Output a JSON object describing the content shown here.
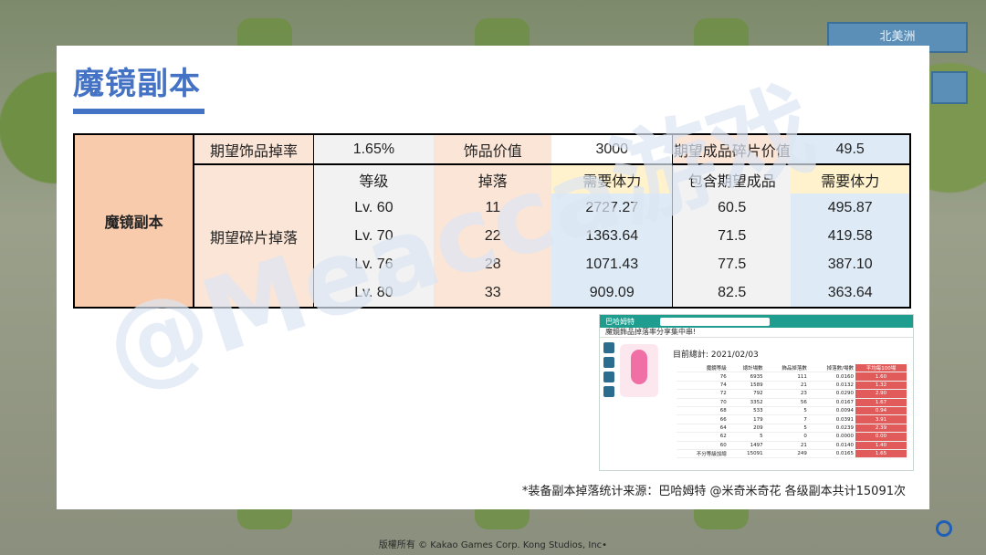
{
  "background": {
    "region_label": "北美洲",
    "copyright": "版權所有 © Kakao Games Corp. Kong Studios, Inc•"
  },
  "slide": {
    "title": "魔镜副本",
    "watermark": "@Meacca游戏",
    "accent_color": "#4472c4",
    "table": {
      "side_label": "魔镜副本",
      "row1": {
        "label1": "期望饰品掉率",
        "value1": "1.65%",
        "label2": "饰品价值",
        "value2": "3000",
        "label3": "期望成品碎片价值",
        "value3": "49.5"
      },
      "sub_label": "期望碎片掉落",
      "headers": [
        "等级",
        "掉落",
        "需要体力",
        "包含期望成品",
        "需要体力"
      ],
      "rows": [
        [
          "Lv. 60",
          "11",
          "2727.27",
          "60.5",
          "495.87"
        ],
        [
          "Lv. 70",
          "22",
          "1363.64",
          "71.5",
          "419.58"
        ],
        [
          "Lv. 76",
          "28",
          "1071.43",
          "77.5",
          "387.10"
        ],
        [
          "Lv. 80",
          "33",
          "909.09",
          "82.5",
          "363.64"
        ]
      ]
    },
    "screenshot": {
      "logo": "巴哈姆特",
      "header": "魔鏡飾品掉落率分享集中串!",
      "date": "目前總計: 2021/02/03",
      "columns": [
        "魔鏡等級",
        "總計場數",
        "飾品掉落數",
        "掉落數/場數",
        "平均每100場"
      ],
      "rows": [
        [
          "76",
          "6935",
          "111",
          "0.0160",
          "1.60"
        ],
        [
          "74",
          "1589",
          "21",
          "0.0132",
          "1.32"
        ],
        [
          "72",
          "792",
          "23",
          "0.0290",
          "2.90"
        ],
        [
          "70",
          "3352",
          "56",
          "0.0167",
          "1.67"
        ],
        [
          "68",
          "533",
          "5",
          "0.0094",
          "0.94"
        ],
        [
          "66",
          "179",
          "7",
          "0.0391",
          "3.91"
        ],
        [
          "64",
          "209",
          "5",
          "0.0239",
          "2.39"
        ],
        [
          "62",
          "5",
          "0",
          "0.0000",
          "0.00"
        ],
        [
          "60",
          "1497",
          "21",
          "0.0140",
          "1.40"
        ]
      ],
      "total": [
        "不分等級加總",
        "15091",
        "249",
        "0.0165",
        "1.65"
      ]
    },
    "note": "*装备副本掉落统计来源：巴哈姆特 @米奇米奇花 各级副本共计15091次"
  }
}
